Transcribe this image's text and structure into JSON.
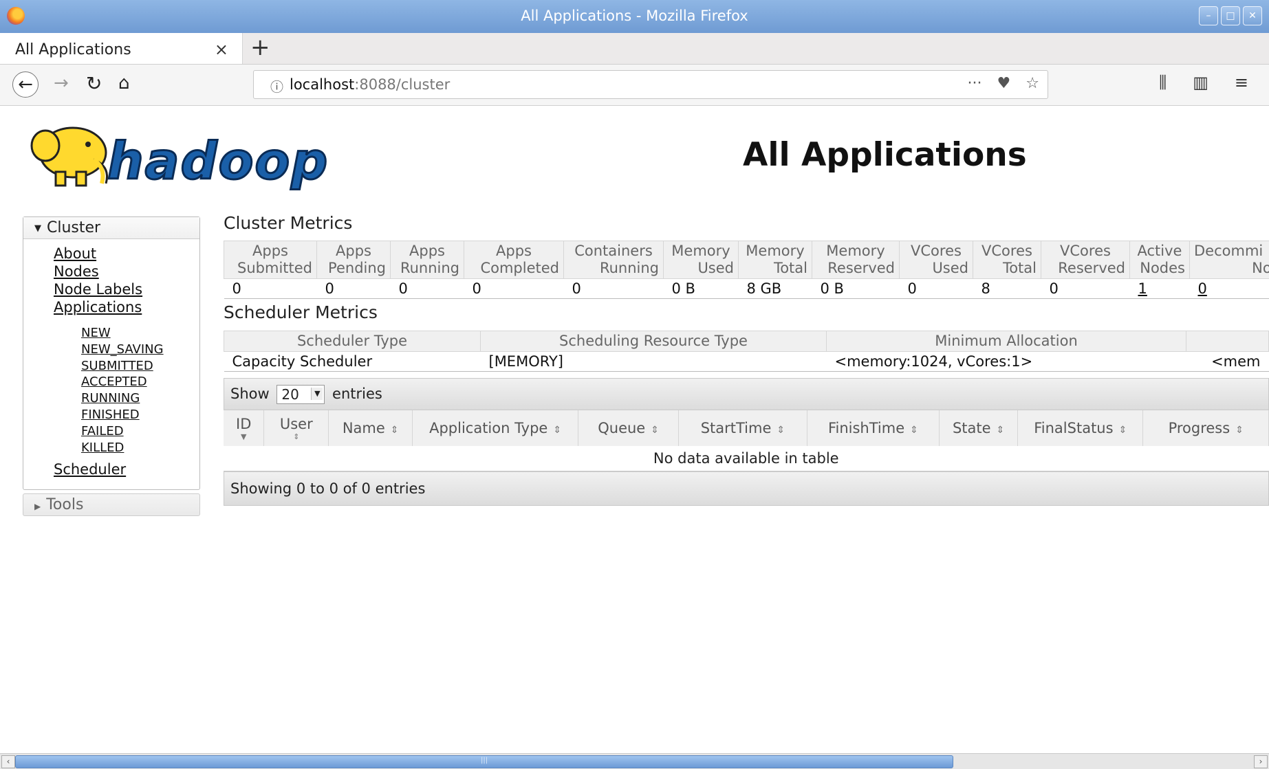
{
  "window": {
    "title": "All Applications - Mozilla Firefox"
  },
  "tabs": [
    {
      "label": "All Applications"
    }
  ],
  "nav": {
    "url_host": "localhost",
    "url_path": ":8088/cluster"
  },
  "page": {
    "title": "All Applications"
  },
  "sidebar": {
    "cluster_label": "Cluster",
    "links": [
      "About",
      "Nodes",
      "Node Labels",
      "Applications"
    ],
    "app_states": [
      "NEW",
      "NEW_SAVING",
      "SUBMITTED",
      "ACCEPTED",
      "RUNNING",
      "FINISHED",
      "FAILED",
      "KILLED"
    ],
    "scheduler_link": "Scheduler",
    "tools_label": "Tools"
  },
  "cluster_metrics": {
    "title": "Cluster Metrics",
    "headers": [
      [
        "Apps",
        "Submitted"
      ],
      [
        "Apps",
        "Pending"
      ],
      [
        "Apps",
        "Running"
      ],
      [
        "Apps",
        "Completed"
      ],
      [
        "Containers",
        "Running"
      ],
      [
        "Memory",
        "Used"
      ],
      [
        "Memory",
        "Total"
      ],
      [
        "Memory",
        "Reserved"
      ],
      [
        "VCores",
        "Used"
      ],
      [
        "VCores",
        "Total"
      ],
      [
        "VCores",
        "Reserved"
      ],
      [
        "Active",
        "Nodes"
      ],
      [
        "Decommi",
        "Nod"
      ]
    ],
    "values": [
      "0",
      "0",
      "0",
      "0",
      "0",
      "0 B",
      "8 GB",
      "0 B",
      "0",
      "8",
      "0",
      "1",
      "0"
    ]
  },
  "scheduler_metrics": {
    "title": "Scheduler Metrics",
    "headers": [
      "Scheduler Type",
      "Scheduling Resource Type",
      "Minimum Allocation",
      ""
    ],
    "values": [
      "Capacity Scheduler",
      "[MEMORY]",
      "<memory:1024, vCores:1>",
      "<mem"
    ]
  },
  "apps_table": {
    "show_label": "Show",
    "entries_value": "20",
    "entries_label": "entries",
    "columns": [
      "ID",
      "User",
      "Name",
      "Application Type",
      "Queue",
      "StartTime",
      "FinishTime",
      "State",
      "FinalStatus",
      "Progress"
    ],
    "empty_message": "No data available in table",
    "footer": "Showing 0 to 0 of 0 entries"
  },
  "logo_text": "hadoop"
}
